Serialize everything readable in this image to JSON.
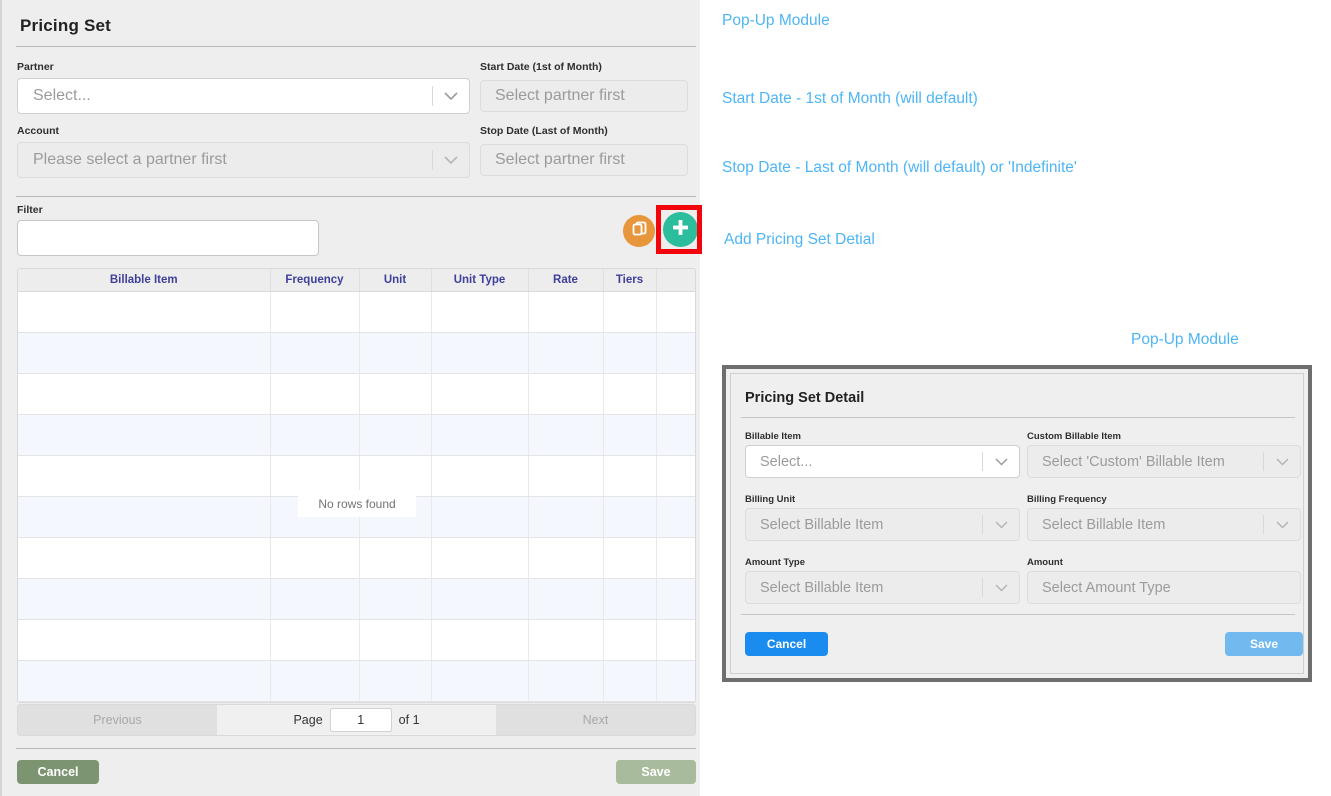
{
  "panel": {
    "title": "Pricing Set",
    "fields": {
      "partner_label": "Partner",
      "partner_value": "Select...",
      "account_label": "Account",
      "account_value": "Please select a partner first",
      "start_date_label": "Start Date (1st of Month)",
      "start_date_value": "Select partner first",
      "stop_date_label": "Stop Date (Last of Month)",
      "stop_date_value": "Select partner first",
      "filter_label": "Filter",
      "filter_value": ""
    },
    "toolbar": {
      "copy_icon": "copy-icon",
      "add_icon": "plus-icon"
    },
    "grid": {
      "columns": [
        "Billable Item",
        "Frequency",
        "Unit",
        "Unit Type",
        "Rate",
        "Tiers",
        ""
      ],
      "rows": [],
      "row_count": 10,
      "empty_message": "No rows found"
    },
    "pager": {
      "previous_label": "Previous",
      "page_label": "Page",
      "page_value": "1",
      "of_label": "of 1",
      "next_label": "Next"
    },
    "footer": {
      "cancel_label": "Cancel",
      "save_label": "Save"
    }
  },
  "annotations": {
    "popup_module_1": "Pop-Up Module",
    "start_date": "Start Date - 1st of Month (will default)",
    "stop_date": "Stop Date - Last of Month (will default) or 'Indefinite'",
    "add_pricing_set_detail": "Add Pricing Set Detial",
    "popup_module_2": "Pop-Up Module"
  },
  "dialog": {
    "title": "Pricing Set Detail",
    "fields": {
      "billable_item_label": "Billable Item",
      "billable_item_value": "Select...",
      "custom_billable_item_label": "Custom Billable Item",
      "custom_billable_item_value": "Select 'Custom' Billable Item",
      "billing_unit_label": "Billing Unit",
      "billing_unit_value": "Select Billable Item",
      "billing_frequency_label": "Billing Frequency",
      "billing_frequency_value": "Select Billable Item",
      "amount_type_label": "Amount Type",
      "amount_type_value": "Select Billable Item",
      "amount_label": "Amount",
      "amount_value": "Select Amount Type"
    },
    "cancel_label": "Cancel",
    "save_label": "Save"
  },
  "colors": {
    "annotation_blue": "#4db5f5",
    "add_button_green": "#2bbd9c",
    "copy_button_orange": "#e8963c",
    "highlight_red": "#f2050a",
    "footer_green": "#7d9470",
    "dialog_blue": "#1a8cf0",
    "grid_header_text": "#3f3f9c"
  }
}
